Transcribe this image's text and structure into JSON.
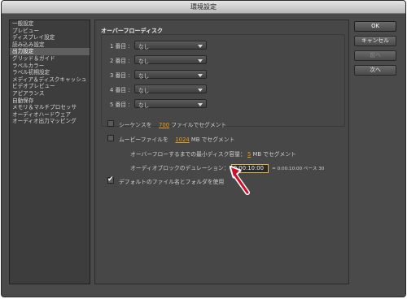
{
  "window": {
    "title": "環境設定"
  },
  "sidebar": {
    "items": [
      {
        "label": "一般設定",
        "selected": false
      },
      {
        "label": "プレビュー",
        "selected": false
      },
      {
        "label": "ディスプレイ設定",
        "selected": false
      },
      {
        "label": "読み込み設定",
        "selected": false
      },
      {
        "label": "出力設定",
        "selected": true
      },
      {
        "label": "グリッド＆ガイド",
        "selected": false
      },
      {
        "label": "ラベルカラー",
        "selected": false
      },
      {
        "label": "ラベル初期設定",
        "selected": false
      },
      {
        "label": "メディア＆ディスクキャッシュ",
        "selected": false
      },
      {
        "label": "ビデオプレビュー",
        "selected": false
      },
      {
        "label": "アピアランス",
        "selected": false
      },
      {
        "label": "自動保存",
        "selected": false
      },
      {
        "label": "メモリ＆マルチプロセッサ",
        "selected": false
      },
      {
        "label": "オーディオハードウェア",
        "selected": false
      },
      {
        "label": "オーディオ出力マッピング",
        "selected": false
      }
    ]
  },
  "overflow": {
    "title": "オーバーフローディスク",
    "rows": [
      {
        "label": "1 番目 :",
        "value": "なし"
      },
      {
        "label": "2 番目 :",
        "value": "なし"
      },
      {
        "label": "3 番目 :",
        "value": "なし"
      },
      {
        "label": "4 番目 :",
        "value": "なし"
      },
      {
        "label": "5 番目 :",
        "value": "なし"
      }
    ]
  },
  "segment_sequence": {
    "checked": false,
    "prefix": "シーケンスを",
    "value": "700",
    "suffix": "ファイルでセグメント"
  },
  "segment_movie": {
    "checked": false,
    "prefix": "ムービーファイルを",
    "value": "1024",
    "suffix": "MB でセグメント"
  },
  "min_disk": {
    "prefix": "オーバーフローするまでの最小ディスク容量：",
    "value": "5",
    "suffix": "MB でセグメント"
  },
  "audio_block": {
    "label": "オーディオブロックのデュレーション：",
    "value": "0:00:10:00",
    "note": "= 0:00:10:00  ベース 30"
  },
  "default_names": {
    "checked": true,
    "label": "デフォルトのファイル名とフォルダを使用"
  },
  "buttons": {
    "ok": "OK",
    "cancel": "キャンセル",
    "prev": "前へ",
    "next": "次へ"
  },
  "colors": {
    "accent_number": "#e59b1d",
    "pointer_arrow": "#d0102a",
    "input_highlight": "#e0b84a"
  }
}
